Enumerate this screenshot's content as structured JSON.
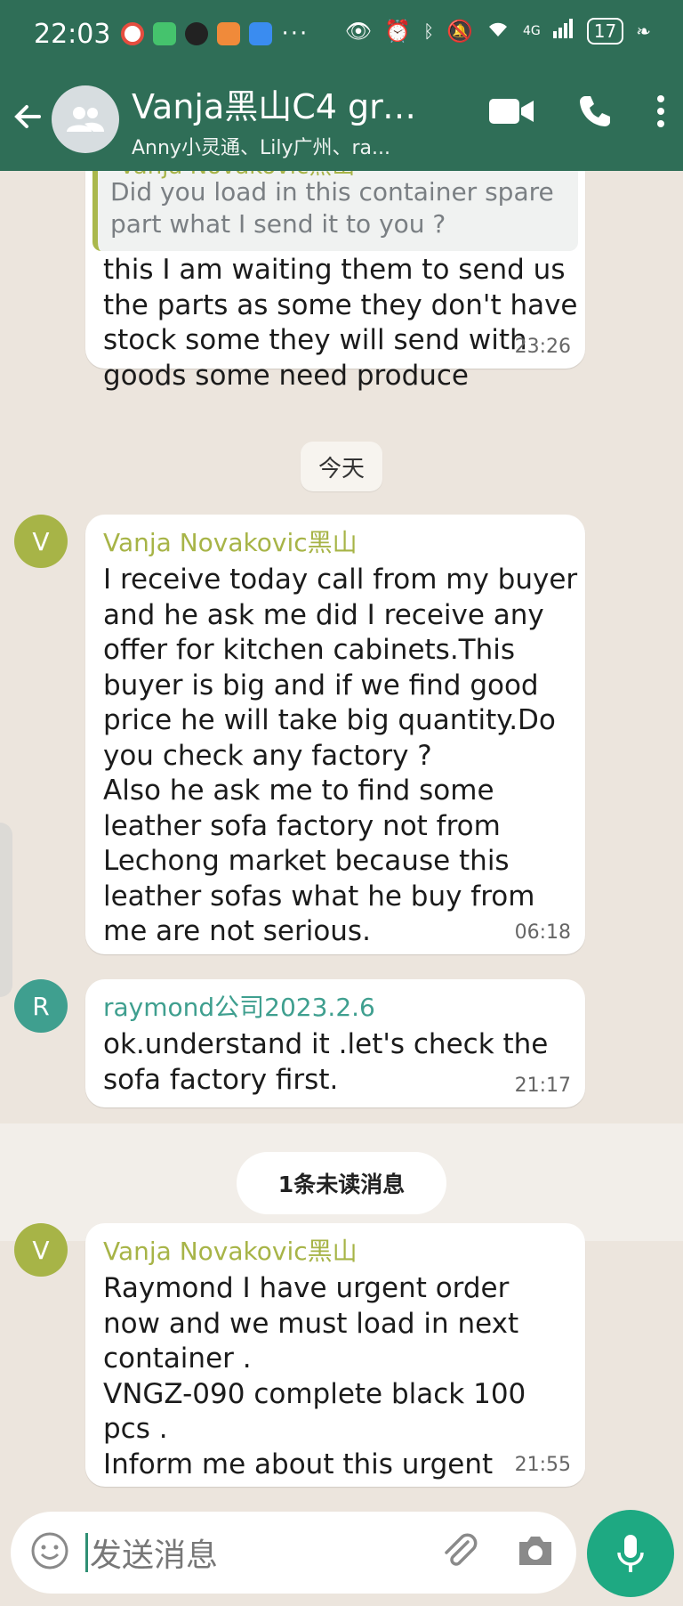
{
  "status_bar": {
    "time": "22:03",
    "dots": "···",
    "network": "4G",
    "battery": "17"
  },
  "header": {
    "title": "Vanja黑山C4 gro...",
    "subtitle": "Anny小灵通、Lily广州、ra..."
  },
  "messages": [
    {
      "quote_sender": "Vanja Novakovic黑山",
      "quote_text": "Did you load in this container spare\npart what I send it to you ?",
      "text": "this I am waiting them to send us\nthe parts as some they don't have\nstock some they will send with\ngoods some need produce",
      "time": "23:26"
    },
    {
      "avatar": "V",
      "sender": "Vanja Novakovic黑山",
      "text": "I receive today call from my buyer\nand he ask me did I receive any\noffer for kitchen cabinets.This\nbuyer is big and if we find good\nprice he will take big quantity.Do\nyou check any factory ?\nAlso he ask me to find some\nleather sofa factory not from\nLechong market because this\nleather sofas what he buy from\nme  are not  serious.",
      "time": "06:18"
    },
    {
      "avatar": "R",
      "sender": "raymond公司2023.2.6",
      "text": "ok.understand it .let's check the\nsofa factory first.",
      "time": "21:17"
    },
    {
      "avatar": "V",
      "sender": "Vanja Novakovic黑山",
      "text": "Raymond I have urgent order\nnow and we must load in next\ncontainer .\nVNGZ-090 complete black 100\npcs .\nInform me about this urgent",
      "time": "21:55"
    }
  ],
  "date_chip": "今天",
  "unread_label": "1条未读消息",
  "input": {
    "placeholder": "发送消息"
  },
  "colors": {
    "header": "#2f6e57",
    "vanja": "#a7b447",
    "raymond": "#3f9f8f",
    "mic": "#1ea982",
    "wallpaper": "#ece5dd"
  }
}
